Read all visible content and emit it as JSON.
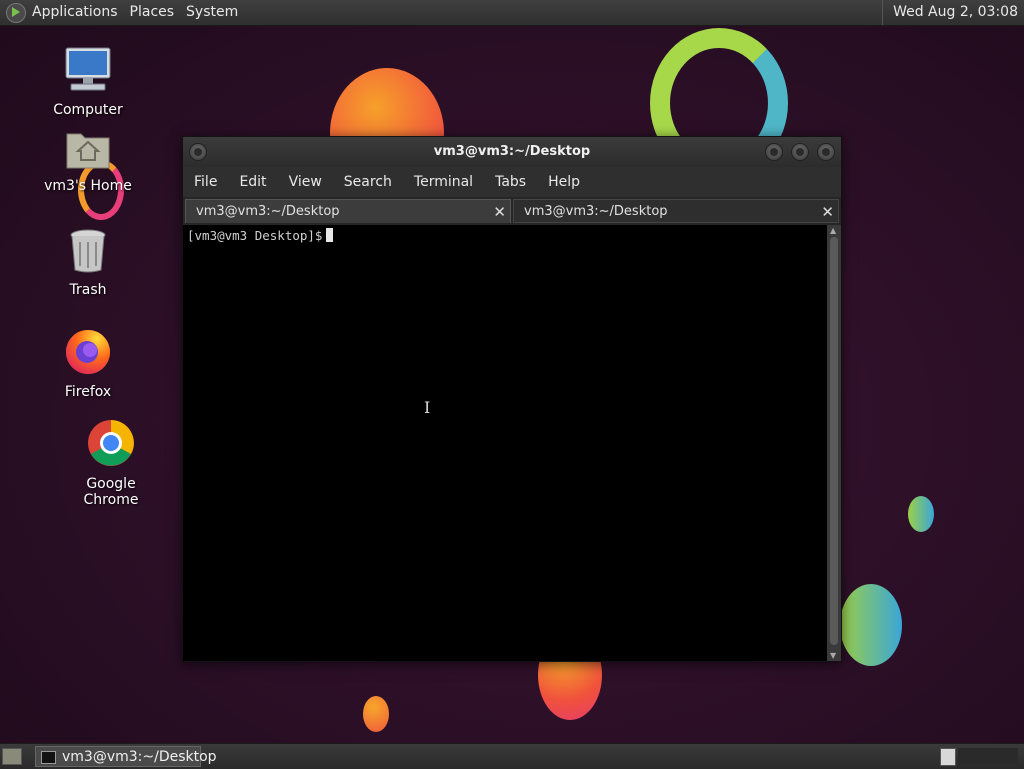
{
  "panel": {
    "menus": [
      "Applications",
      "Places",
      "System"
    ],
    "clock": "Wed Aug  2, 03:08"
  },
  "desktop": {
    "icons": [
      {
        "label": "Computer",
        "icon": "computer-icon"
      },
      {
        "label": "vm3's Home",
        "icon": "home-folder-icon"
      },
      {
        "label": "Trash",
        "icon": "trash-icon"
      },
      {
        "label": "Firefox",
        "icon": "firefox-icon"
      },
      {
        "label": "Google Chrome",
        "icon": "chrome-icon"
      }
    ]
  },
  "terminal": {
    "title": "vm3@vm3:~/Desktop",
    "menus": [
      "File",
      "Edit",
      "View",
      "Search",
      "Terminal",
      "Tabs",
      "Help"
    ],
    "tabs": [
      {
        "label": "vm3@vm3:~/Desktop",
        "active": true
      },
      {
        "label": "vm3@vm3:~/Desktop",
        "active": false
      }
    ],
    "prompt": "[vm3@vm3 Desktop]$"
  },
  "taskbar": {
    "window_label": "vm3@vm3:~/Desktop"
  },
  "colors": {
    "desktop_bg": "#2b0f26",
    "panel_bg": "#333333",
    "terminal_bg": "#000000"
  }
}
